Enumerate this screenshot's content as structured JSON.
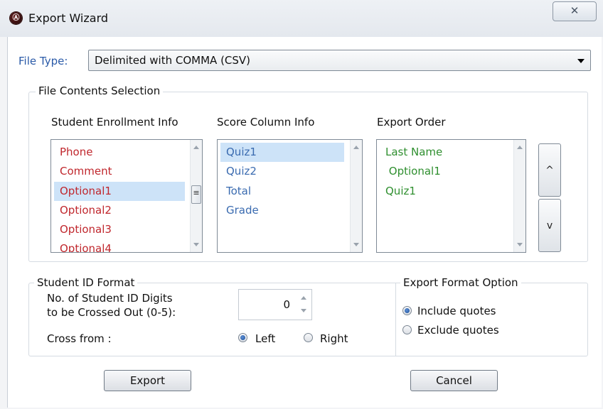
{
  "window": {
    "title": "Export Wizard",
    "close_glyph": "✕",
    "app_icon": "app-logo-icon"
  },
  "file_type": {
    "label": "File Type:",
    "value": "Delimited with COMMA (CSV)"
  },
  "contents": {
    "group_title": "File Contents Selection",
    "enrollment": {
      "header": "Student Enrollment Info",
      "items": [
        "Phone",
        "Comment",
        "Optional1",
        "Optional2",
        "Optional3",
        "Optional4"
      ],
      "selected": "Optional1",
      "color": "#c0272d"
    },
    "score": {
      "header": "Score Column Info",
      "items": [
        "Quiz1",
        "Quiz2",
        "Total",
        "Grade"
      ],
      "selected": "Quiz1",
      "color": "#3a6bb0"
    },
    "order": {
      "header": "Export Order",
      "items": [
        "Last Name",
        " Optional1",
        "Quiz1"
      ],
      "color": "#2f8f2f",
      "move_up_label": "^",
      "move_down_label": "v"
    }
  },
  "student_id": {
    "group_title": "Student ID Format",
    "digits_label_line1": "No. of Student ID Digits",
    "digits_label_line2": "to be Crossed Out (0-5):",
    "digits_value": "0",
    "cross_from_label": "Cross from :",
    "option_left": "Left",
    "option_right": "Right",
    "selected": "Left"
  },
  "export_format": {
    "group_title": "Export Format Option",
    "include_label": "Include quotes",
    "exclude_label": "Exclude quotes",
    "selected": "Include quotes"
  },
  "buttons": {
    "export": "Export",
    "cancel": "Cancel"
  }
}
